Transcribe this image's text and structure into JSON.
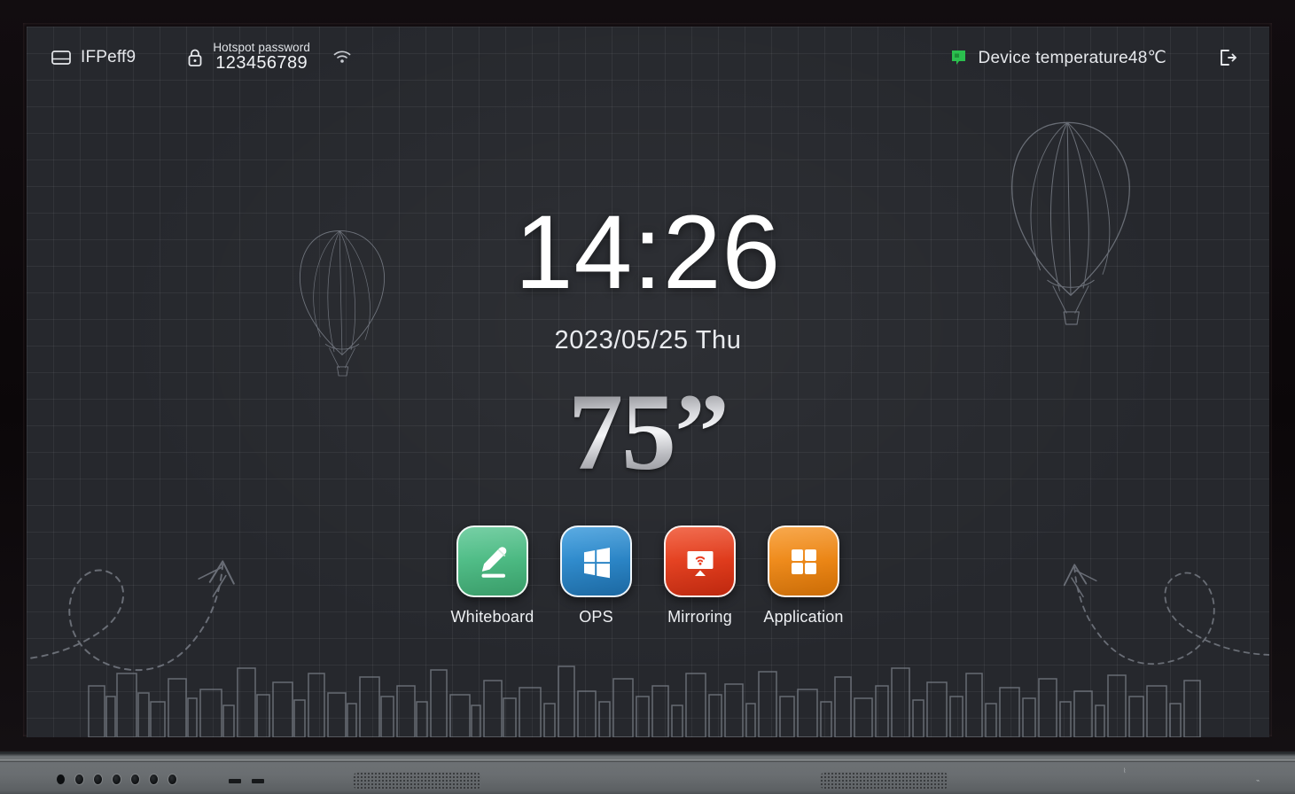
{
  "device": {
    "type": "interactive-flat-panel",
    "screen_size_label": "75”"
  },
  "status_bar": {
    "device_name": {
      "icon": "display-icon",
      "label": "IFPeff9"
    },
    "hotspot": {
      "icon": "lock-icon",
      "title": "Hotspot password",
      "password": "123456789"
    },
    "wifi": {
      "icon": "wifi-icon",
      "label": ""
    },
    "temperature": {
      "icon": "temperature-monitor-icon",
      "icon_color": "#2bbf4e",
      "label": "Device temperature48℃"
    },
    "exit": {
      "icon": "exit-icon",
      "label": ""
    }
  },
  "clock": {
    "time": "14:26",
    "date": "2023/05/25 Thu"
  },
  "dock": {
    "apps": [
      {
        "id": "whiteboard",
        "label": "Whiteboard",
        "icon": "pencil-icon",
        "color": "#4fbe87",
        "color_dark": "#3aa66f"
      },
      {
        "id": "ops",
        "label": "OPS",
        "icon": "windows-icon",
        "color": "#2a8cd4",
        "color_dark": "#1e6fae"
      },
      {
        "id": "mirroring",
        "label": "Mirroring",
        "icon": "screen-cast-icon",
        "color": "#ea3f24",
        "color_dark": "#cf2f16"
      },
      {
        "id": "application",
        "label": "Application",
        "icon": "grid-apps-icon",
        "color": "#f08a1a",
        "color_dark": "#dd7708"
      }
    ]
  },
  "decor": {
    "balloon_left": "hot-air-balloon-sketch",
    "balloon_right": "hot-air-balloon-sketch",
    "arrow_left": "dashed-loop-arrow",
    "arrow_right": "dashed-loop-arrow",
    "skyline": "city-skyline-outline",
    "background": "#26282d",
    "grid_line_color": "rgba(255,255,255,0.055)"
  },
  "bezel": {
    "indicator_dots": 7,
    "speaker_grilles": 2,
    "mark_a": "⌇",
    "mark_b": "⌁"
  }
}
